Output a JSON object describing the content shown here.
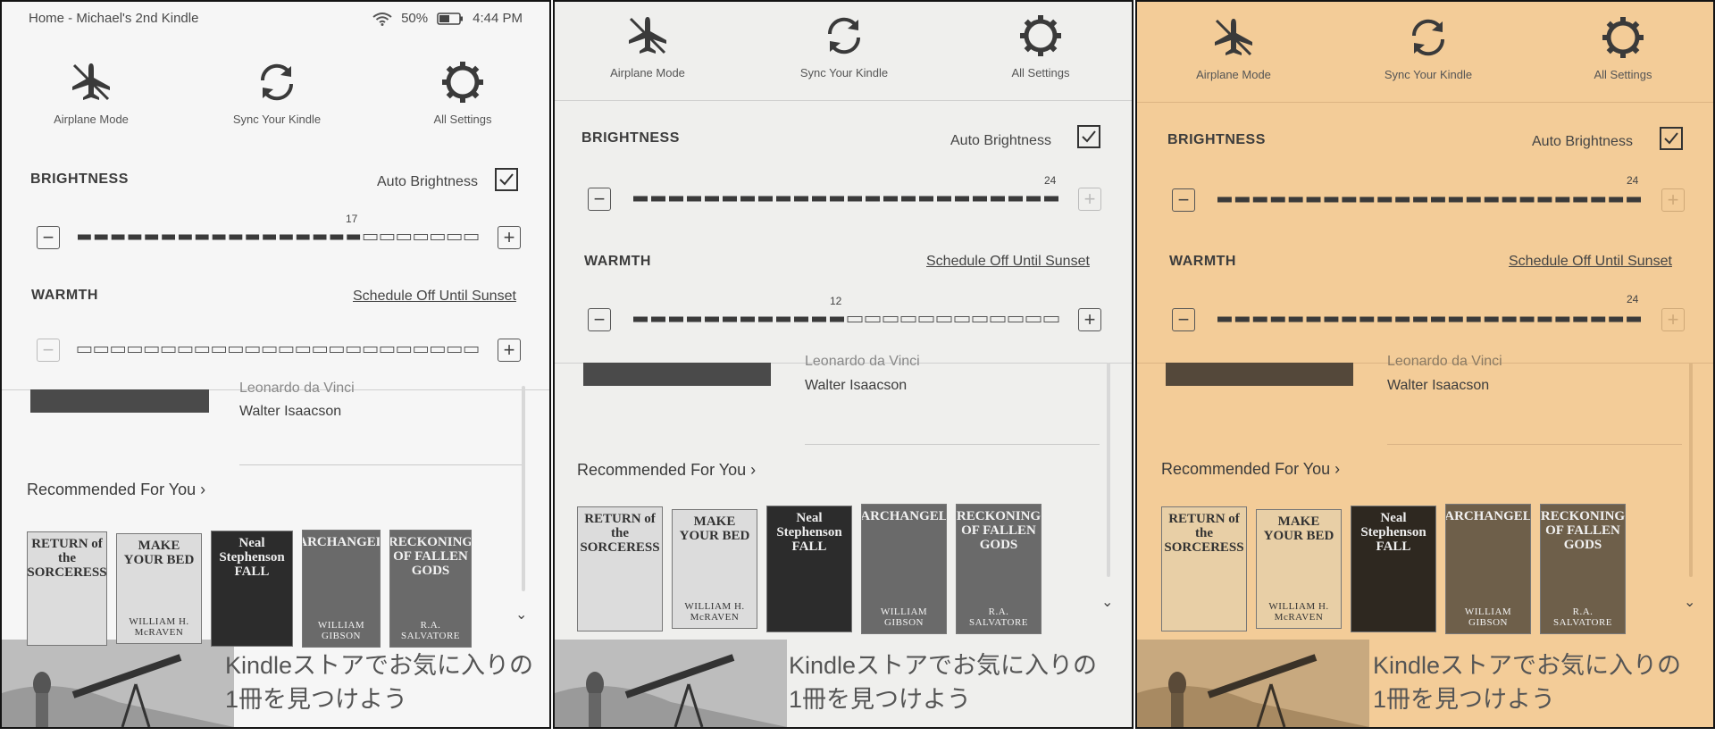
{
  "status_bar": {
    "title": "Home - Michael's 2nd Kindle",
    "battery": "50%",
    "time": "4:44 PM",
    "icons": [
      "wifi-icon",
      "battery-icon"
    ]
  },
  "quick_actions": {
    "airplane_label": "Airplane Mode",
    "sync_label": "Sync Your Kindle",
    "settings_label": "All Settings",
    "icons": [
      "airplane-icon",
      "sync-icon",
      "gear-icon"
    ]
  },
  "settings_labels": {
    "brightness": "BRIGHTNESS",
    "auto_brightness": "Auto Brightness",
    "warmth": "WARMTH",
    "schedule": "Schedule Off Until Sunset",
    "minus_icon": "minus-icon",
    "plus_icon": "plus-icon"
  },
  "panels": [
    {
      "theme_color": "#f6f6f6",
      "brightness_level": "17",
      "brightness_value": 17,
      "warmth_value": 0,
      "warmth_level": "",
      "auto_brightness_checked": true
    },
    {
      "theme_color": "#efefed",
      "brightness_level": "24",
      "brightness_value": 24,
      "warmth_value": 12,
      "warmth_level": "12",
      "auto_brightness_checked": true
    },
    {
      "theme_color": "#f3cc98",
      "brightness_level": "24",
      "brightness_value": 24,
      "warmth_value": 24,
      "warmth_level": "24",
      "auto_brightness_checked": true
    }
  ],
  "slider_max": 24,
  "library": {
    "book_title": "Leonardo da Vinci",
    "book_author": "Walter Isaacson",
    "recommended_header": "Recommended For You",
    "chevron_right": "›",
    "chevron_down": "⌄"
  },
  "recommended_books": [
    {
      "title": "RETURN of the SORCERESS",
      "author": "",
      "style": "light"
    },
    {
      "title": "MAKE YOUR BED",
      "author": "WILLIAM H. McRAVEN",
      "style": "light"
    },
    {
      "title": "Neal Stephenson FALL",
      "author": "",
      "style": "dark"
    },
    {
      "title": "ARCHANGEL",
      "author": "WILLIAM GIBSON",
      "style": "mid"
    },
    {
      "title": "RECKONING OF FALLEN GODS",
      "author": "R.A. SALVATORE",
      "style": "mid"
    }
  ],
  "banner": {
    "line1": "Kindleストアでお気に入りの",
    "line2": "1冊を見つけよう"
  }
}
